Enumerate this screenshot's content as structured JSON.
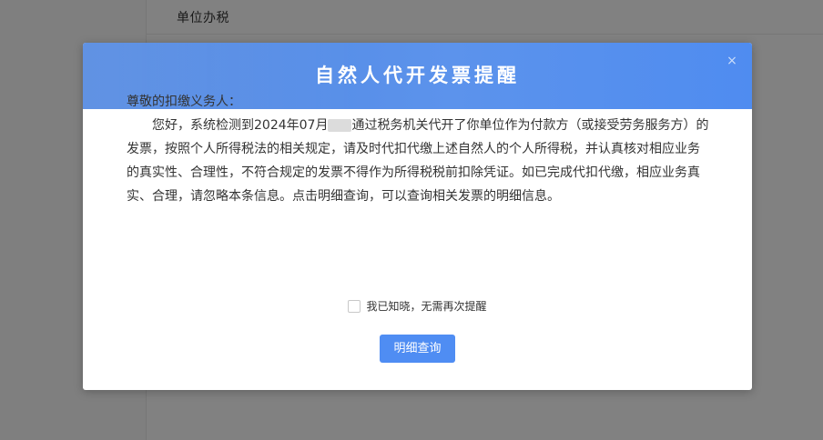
{
  "background": {
    "header_title": "单位办税"
  },
  "dialog": {
    "title": "自然人代开发票提醒",
    "close_icon": "close-icon",
    "salutation": "尊敬的扣缴义务人：",
    "message_part1": "您好，系统检测到2024年07月",
    "message_part2": "通过税务机关代开了你单位作为付款方（或接受劳务服务方）的发票，按照个人所得税法的相关规定，请及时代扣代缴上述自然人的个人所得税，并认真核对相应业务的真实性、合理性，不符合规定的发票不得作为所得税税前扣除凭证。如已完成代扣代缴，相应业务真实、合理，请忽略本条信息。点击明细查询，可以查询相关发票的明细信息。",
    "dismiss_checkbox_label": "我已知晓，无需再次提醒",
    "dismiss_checked": false,
    "detail_button_label": "明细查询"
  },
  "colors": {
    "header_gradient_start": "#4f86e0",
    "header_gradient_end": "#4f8cf0",
    "button": "#4f8df3",
    "overlay": "#7f7f7f"
  }
}
